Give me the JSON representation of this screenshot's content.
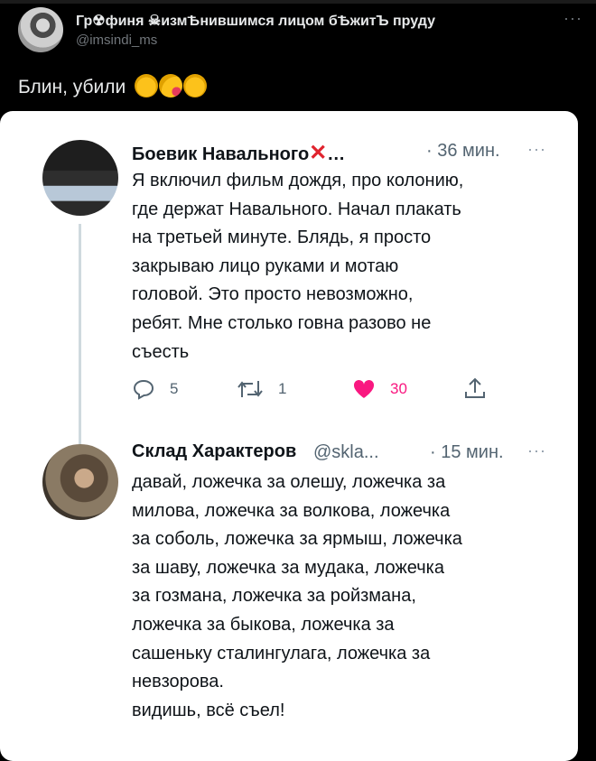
{
  "outer_tweet": {
    "display_name": "Гр☢финя ☠измѢнившимся лицом бѢжитЪ пруду",
    "handle": "@imsindi_ms",
    "text": "Блин, убили",
    "emojis": [
      "rolling-laughing-emoji",
      "kiss-emoji",
      "rolling-laughing-emoji"
    ]
  },
  "quoted_thread": [
    {
      "display_name": "Боевик Навального",
      "name_suffix": "…",
      "time": "· 36 мин.",
      "text": "Я включил фильм дождя, про колонию, \nгде держат Навального. Начал плакать \nна третьей минуте. Блядь, я просто \nзакрываю лицо руками и мотаю \nголовой. Это просто невозможно, \nребят. Мне столько говна разово не \nсъесть",
      "replies": "5",
      "retweets": "1",
      "likes": "30"
    },
    {
      "display_name": "Склад Характеров",
      "handle": "@skla...",
      "time": "· 15 мин.",
      "text": "давай, ложечка за олешу, ложечка за \nмилова, ложечка за волкова, ложечка \nза соболь, ложечка за ярмыш, ложечка \nза шаву, ложечка за мудака, ложечка \nза гозмана, ложечка за ройзмана, \nложечка за быкова, ложечка за \nсашеньку сталингулага, ложечка за \nневзорова.\nвидишь, всё съел!"
    }
  ],
  "colors": {
    "like": "#f91880",
    "thread_line": "#cfd9de",
    "muted": "#71767b",
    "icon": "#536471"
  }
}
